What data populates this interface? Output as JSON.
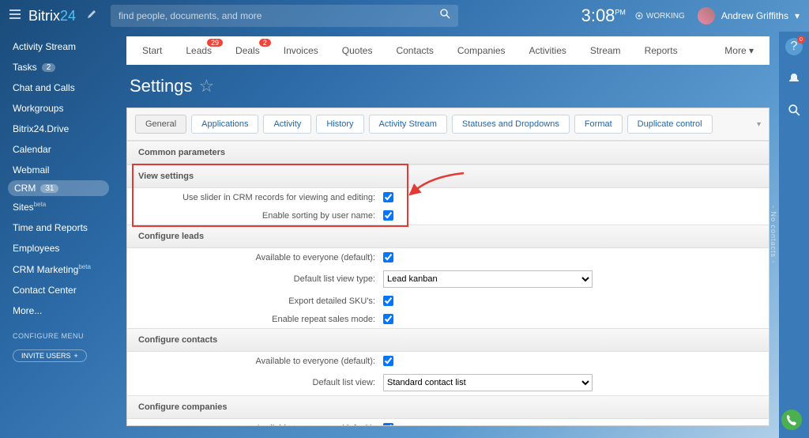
{
  "brand": {
    "name": "Bitrix",
    "suffix": "24"
  },
  "search": {
    "placeholder": "find people, documents, and more"
  },
  "header": {
    "time": "3:08",
    "ampm": "PM",
    "status": "WORKING",
    "user": "Andrew Griffiths"
  },
  "sidebar": {
    "items": [
      {
        "label": "Activity Stream"
      },
      {
        "label": "Tasks",
        "badge": "2"
      },
      {
        "label": "Chat and Calls"
      },
      {
        "label": "Workgroups"
      },
      {
        "label": "Bitrix24.Drive"
      },
      {
        "label": "Calendar"
      },
      {
        "label": "Webmail"
      },
      {
        "label": "CRM",
        "badge": "31",
        "active": true
      },
      {
        "label": "Sites",
        "sup": "beta"
      },
      {
        "label": "Time and Reports"
      },
      {
        "label": "Employees"
      },
      {
        "label": "CRM Marketing",
        "sup": "beta"
      },
      {
        "label": "Contact Center"
      },
      {
        "label": "More..."
      }
    ],
    "configure": "CONFIGURE MENU",
    "invite": "INVITE USERS"
  },
  "crmnav": {
    "items": [
      "Start",
      "Leads",
      "Deals",
      "Invoices",
      "Quotes",
      "Contacts",
      "Companies",
      "Activities",
      "Stream",
      "Reports"
    ],
    "badges": {
      "Leads": "29",
      "Deals": "2"
    },
    "more": "More"
  },
  "page": {
    "title": "Settings"
  },
  "tabs": [
    "General",
    "Applications",
    "Activity",
    "History",
    "Activity Stream",
    "Statuses and Dropdowns",
    "Format",
    "Duplicate control"
  ],
  "sections": {
    "common": "Common parameters",
    "view": {
      "title": "View settings",
      "rows": [
        {
          "label": "Use slider in CRM records for viewing and editing:",
          "checked": true
        },
        {
          "label": "Enable sorting by user name:",
          "checked": true
        }
      ]
    },
    "leads": {
      "title": "Configure leads",
      "rows": [
        {
          "label": "Available to everyone (default):",
          "type": "check",
          "checked": true
        },
        {
          "label": "Default list view type:",
          "type": "select",
          "value": "Lead kanban"
        },
        {
          "label": "Export detailed SKU's:",
          "type": "check",
          "checked": true
        },
        {
          "label": "Enable repeat sales mode:",
          "type": "check",
          "checked": true
        }
      ]
    },
    "contacts": {
      "title": "Configure contacts",
      "rows": [
        {
          "label": "Available to everyone (default):",
          "type": "check",
          "checked": true
        },
        {
          "label": "Default list view:",
          "type": "select",
          "value": "Standard contact list"
        }
      ]
    },
    "companies": {
      "title": "Configure companies",
      "rows": [
        {
          "label": "Available to everyone (default):",
          "type": "check",
          "checked": true
        }
      ]
    }
  },
  "rail": {
    "vert": "- No contacts -"
  }
}
